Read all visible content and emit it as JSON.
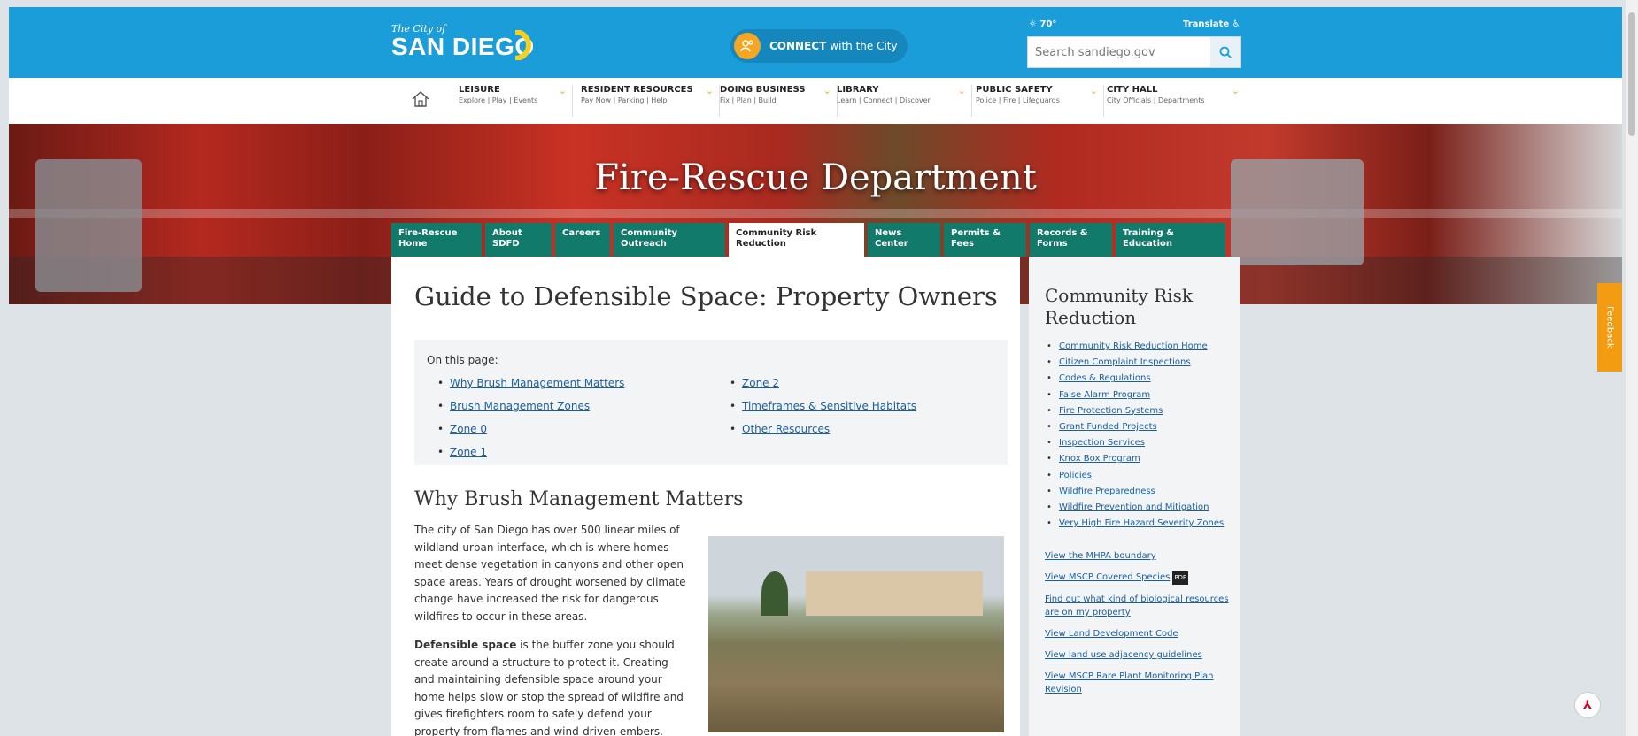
{
  "header": {
    "logo_small": "The City of",
    "logo_big": "SAN DIEGO",
    "connect_bold": "CONNECT",
    "connect_rest": "with the City",
    "weather": "70°",
    "translate": "Translate",
    "search_placeholder": "Search sandiego.gov"
  },
  "nav": [
    {
      "title": "LEISURE",
      "sub": "Explore | Play | Events"
    },
    {
      "title": "RESIDENT RESOURCES",
      "sub": "Pay Now | Parking | Help"
    },
    {
      "title": "DOING BUSINESS",
      "sub": "Fix | Plan | Build"
    },
    {
      "title": "LIBRARY",
      "sub": "Learn | Connect | Discover"
    },
    {
      "title": "PUBLIC SAFETY",
      "sub": "Police | Fire | Lifeguards"
    },
    {
      "title": "CITY HALL",
      "sub": "City Officials | Departments"
    }
  ],
  "hero": {
    "title": "Fire-Rescue Department"
  },
  "subtabs": [
    {
      "line1": "Fire-Rescue",
      "line2": "Home"
    },
    {
      "line1": "About",
      "line2": "SDFD"
    },
    {
      "line1": "Careers",
      "line2": ""
    },
    {
      "line1": "Community",
      "line2": "Outreach"
    },
    {
      "line1": "Community Risk",
      "line2": "Reduction"
    },
    {
      "line1": "News",
      "line2": "Center"
    },
    {
      "line1": "Permits &",
      "line2": "Fees"
    },
    {
      "line1": "Records &",
      "line2": "Forms"
    },
    {
      "line1": "Training &",
      "line2": "Education"
    }
  ],
  "main": {
    "title": "Guide to Defensible Space: Property Owners",
    "toc_label": "On this page:",
    "toc_col1": [
      "Why Brush Management Matters",
      "Brush Management Zones",
      "Zone 0",
      "Zone 1"
    ],
    "toc_col2": [
      "Zone 2",
      "Timeframes & Sensitive Habitats",
      "Other Resources"
    ],
    "section_title": "Why Brush Management Matters",
    "para1": "The city of San Diego has over 500 linear miles of wildland-urban interface, which is where homes meet dense vegetation in canyons and other open space areas. Years of drought worsened by climate change have increased the risk for dangerous wildfires to occur in these areas.",
    "para2_bold": "Defensible space",
    "para2_rest": " is the buffer zone you should create around a structure to protect it. Creating and maintaining defensible space around your home helps slow or stop the spread of wildfire and gives firefighters room to safely defend your property from flames and wind-driven embers."
  },
  "sidebar": {
    "title": "Community Risk Reduction",
    "items": [
      "Community Risk Reduction Home",
      "Citizen Complaint Inspections",
      "Codes & Regulations",
      "False Alarm Program",
      "Fire Protection Systems",
      "Grant Funded Projects",
      "Inspection Services",
      "Knox Box Program",
      "Policies",
      "Wildfire Preparedness",
      "Wildfire Prevention and Mitigation",
      "Very High Fire Hazard Severity Zones"
    ],
    "links": [
      "View the MHPA boundary",
      "View MSCP Covered Species",
      "Find out what kind of biological resources are on my property",
      "View Land Development Code",
      "View land use adjacency guidelines",
      "View MSCP Rare Plant Monitoring Plan Revision"
    ],
    "pdf_badge": "PDF"
  },
  "feedback": "Feedback",
  "colors": {
    "header_blue": "#1a9dd9",
    "tab_green": "#117a6a",
    "accent_orange": "#f5a623",
    "link_blue": "#1a5fa0"
  }
}
